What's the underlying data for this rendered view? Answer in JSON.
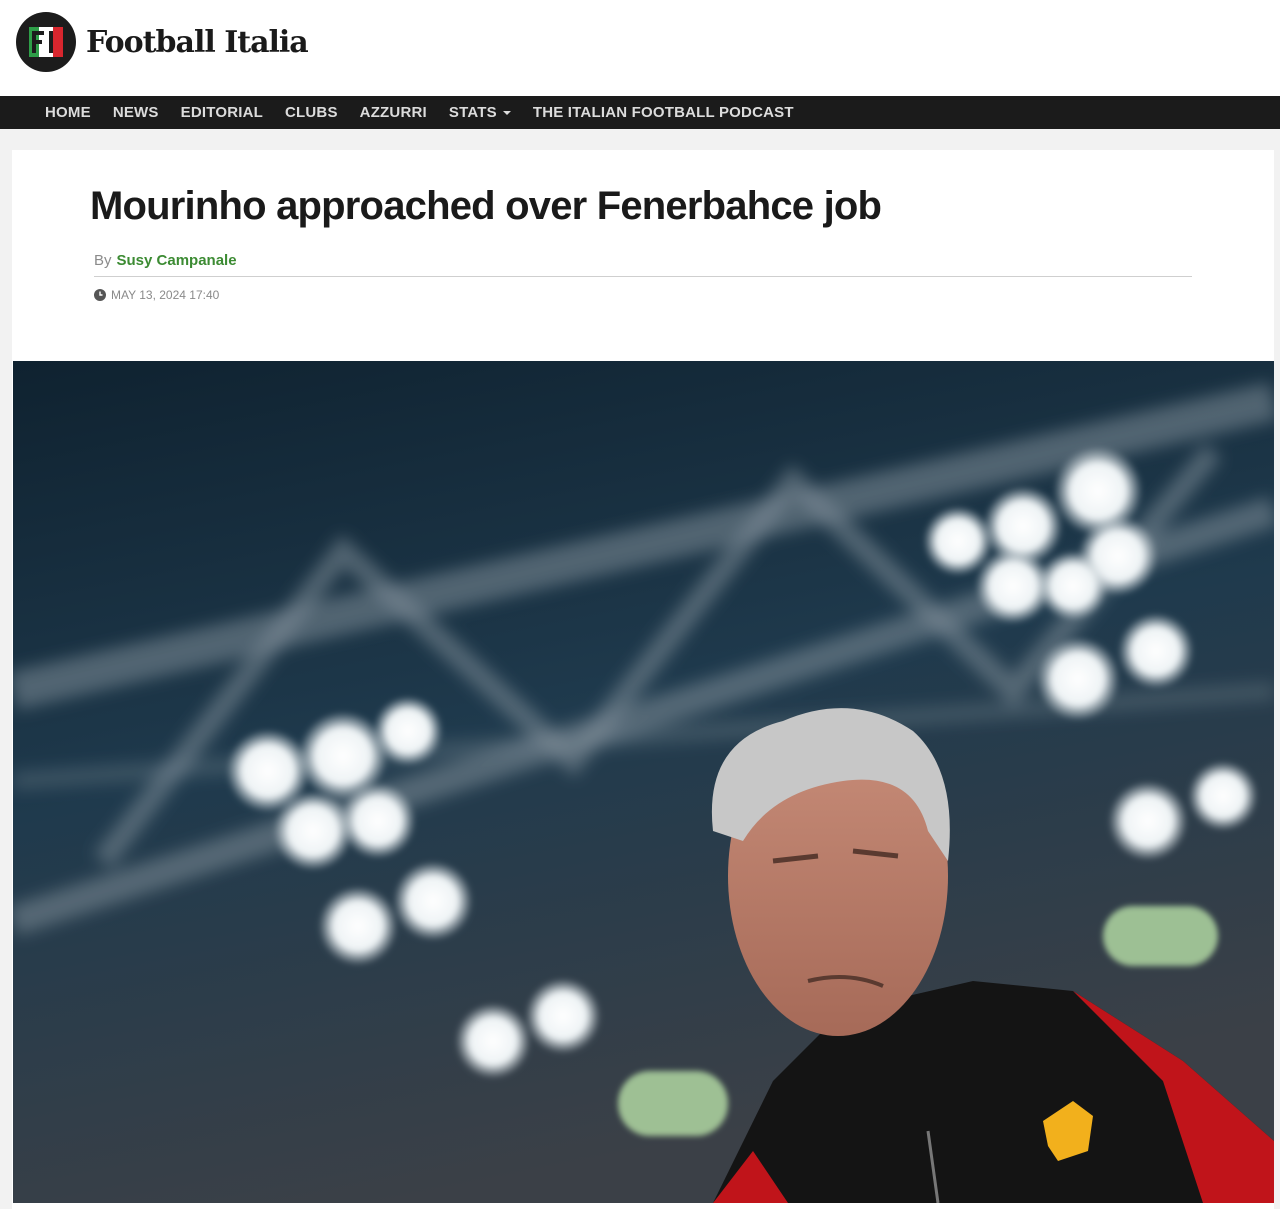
{
  "site": {
    "name": "Football Italia",
    "logo_letters": "FI"
  },
  "nav": {
    "items": [
      {
        "label": "HOME"
      },
      {
        "label": "NEWS"
      },
      {
        "label": "EDITORIAL"
      },
      {
        "label": "CLUBS"
      },
      {
        "label": "AZZURRI"
      },
      {
        "label": "STATS",
        "has_dropdown": true
      },
      {
        "label": "THE ITALIAN FOOTBALL PODCAST"
      }
    ]
  },
  "article": {
    "headline": "Mourinho approached over Fenerbahce job",
    "by_label": "By",
    "author": "Susy Campanale",
    "date": "MAY 13, 2024 17:40",
    "hero_image": {
      "icon": "photo"
    }
  },
  "colors": {
    "nav_bg": "#1b1b1b",
    "author_link": "#3c8b33",
    "logo_green": "#2e9e48",
    "logo_red": "#d8262e"
  }
}
